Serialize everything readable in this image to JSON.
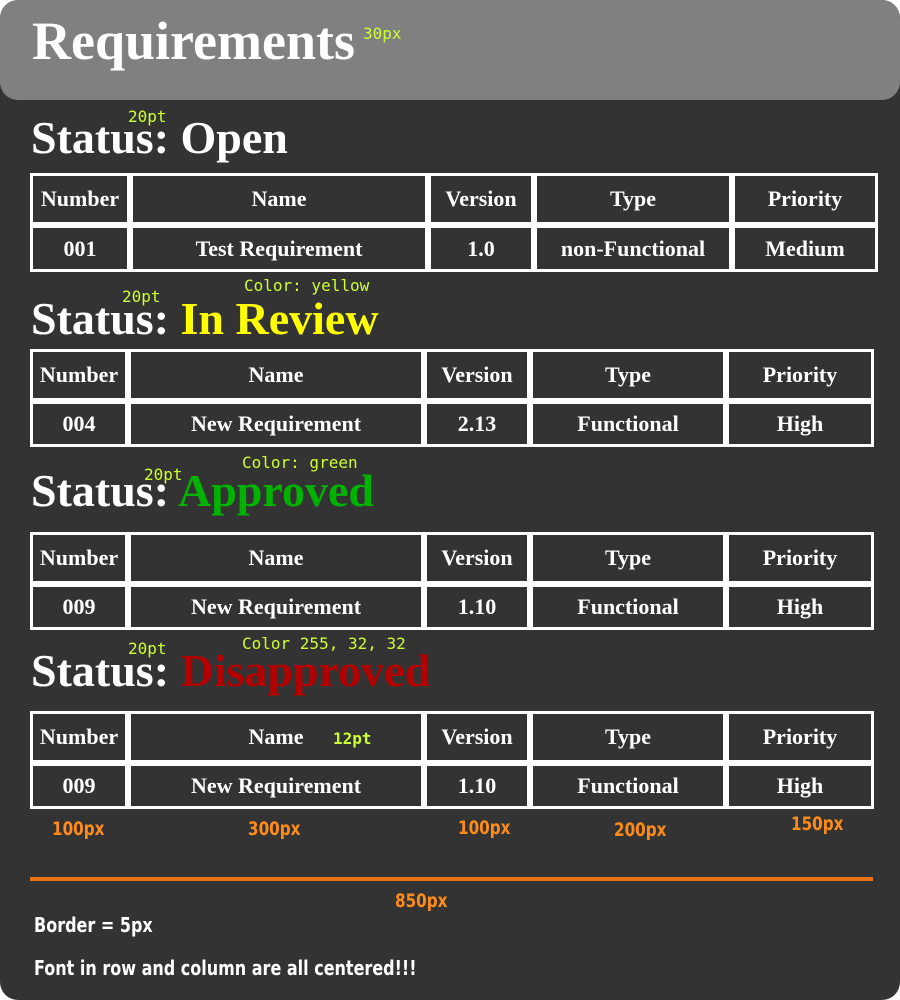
{
  "header": {
    "title": "Requirements",
    "size_annotation": "30px"
  },
  "columns": [
    "Number",
    "Name",
    "Version",
    "Type",
    "Priority"
  ],
  "sections": [
    {
      "label": "Status: ",
      "value": "Open",
      "value_color": "#ffffff",
      "size_annotation": "20pt",
      "color_annotation": "",
      "row": {
        "number": "001",
        "name": "Test Requirement",
        "version": "1.0",
        "type": "non-Functional",
        "priority": "Medium"
      }
    },
    {
      "label": "Status: ",
      "value": "In Review",
      "value_color": "#ffff00",
      "size_annotation": "20pt",
      "color_annotation": "Color: yellow",
      "row": {
        "number": "004",
        "name": "New Requirement",
        "version": "2.13",
        "type": "Functional",
        "priority": "High"
      }
    },
    {
      "label": "Status: ",
      "value": "Approved",
      "value_color": "#00b300",
      "size_annotation": "20pt",
      "color_annotation": "Color: green",
      "row": {
        "number": "009",
        "name": "New Requirement",
        "version": "1.10",
        "type": "Functional",
        "priority": "High"
      }
    },
    {
      "label": "Status: ",
      "value": "Disapproved",
      "value_color": "#b30000",
      "size_annotation": "20pt",
      "color_annotation": "Color 255, 32, 32",
      "header_font_annotation": "12pt",
      "row": {
        "number": "009",
        "name": "New Requirement",
        "version": "1.10",
        "type": "Functional",
        "priority": "High"
      }
    }
  ],
  "column_width_labels": [
    "100px",
    "300px",
    "100px",
    "200px",
    "150px"
  ],
  "total_width_label": "850px",
  "notes": {
    "border": "Border = 5px",
    "alignment": "Font in row and column are all centered!!!"
  },
  "colors": {
    "panel_bg": "#333333",
    "header_bg": "#808080",
    "annotation": "#ccff33",
    "measure": "#ff8c1a"
  }
}
